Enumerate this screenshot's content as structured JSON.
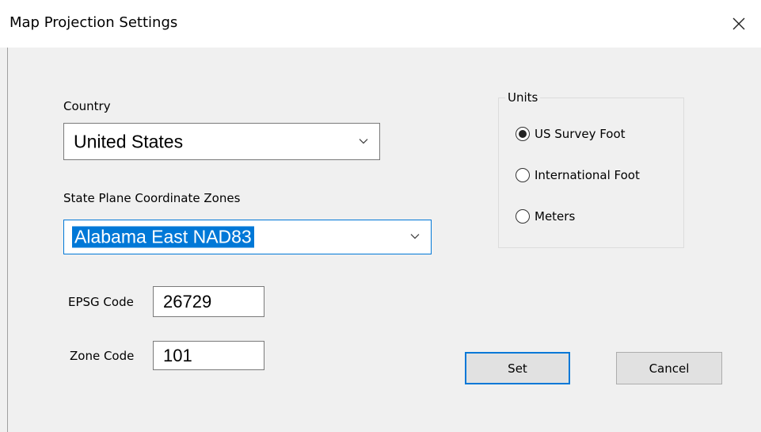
{
  "window": {
    "title": "Map Projection Settings"
  },
  "country": {
    "label": "Country",
    "selected": "United States"
  },
  "zones": {
    "label": "State Plane Coordinate Zones",
    "selected": "Alabama East NAD83"
  },
  "epsg": {
    "label": "EPSG Code",
    "value": "26729"
  },
  "zone_code": {
    "label": "Zone Code",
    "value": "101"
  },
  "units": {
    "title": "Units",
    "options": [
      {
        "label": "US Survey Foot",
        "checked": true
      },
      {
        "label": "International Foot",
        "checked": false
      },
      {
        "label": "Meters",
        "checked": false
      }
    ]
  },
  "buttons": {
    "set": "Set",
    "cancel": "Cancel"
  },
  "icons": {
    "close": "close-icon",
    "dropdown": "chevron-down-icon"
  },
  "colors": {
    "accent": "#0078d7",
    "background": "#f0f0f0",
    "titlebar": "#ffffff"
  }
}
